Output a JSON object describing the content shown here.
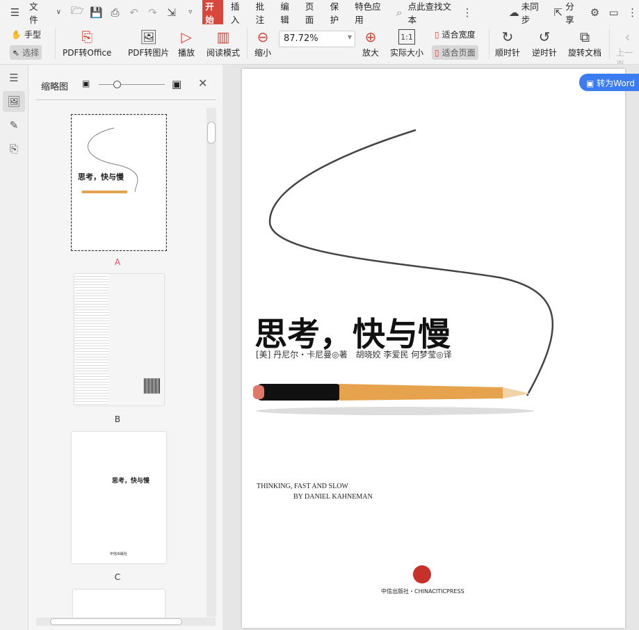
{
  "topbar": {
    "file_menu": "文件",
    "tabs": [
      "开始",
      "插入",
      "批注",
      "编辑",
      "页面",
      "保护",
      "特色应用"
    ],
    "search_placeholder": "点此查找文本",
    "sync": "未同步",
    "share": "分享"
  },
  "toolbar": {
    "hand": "手型",
    "select": "选择",
    "pdf_to_office": "PDF转Office",
    "pdf_to_image": "PDF转图片",
    "play": "播放",
    "read_mode": "阅读模式",
    "zoom_out": "缩小",
    "zoom_value": "87.72%",
    "zoom_in": "放大",
    "actual_size": "实际大小",
    "fit_width": "适合宽度",
    "fit_page": "适合页面",
    "clockwise": "顺时针",
    "counterclockwise": "逆时针",
    "rotate_doc": "旋转文档",
    "prev_page": "上一页"
  },
  "panel": {
    "title": "缩略图",
    "thumbs": [
      {
        "label": "A",
        "title": "思考，快与慢"
      },
      {
        "label": "B"
      },
      {
        "label": "C",
        "title": "思考，快与慢",
        "publisher": "中信出版社"
      }
    ]
  },
  "page": {
    "convert_button": "转为Word",
    "title": "思考，快与慢",
    "authors": "[美] 丹尼尔・卡尼曼◎著　胡晓姣 李爱民 何梦莹◎译",
    "en_title": "THINKING, FAST AND SLOW",
    "en_author": "BY DANIEL KAHNEMAN",
    "publisher": "中信出版社・CHINACITICPRESS"
  }
}
